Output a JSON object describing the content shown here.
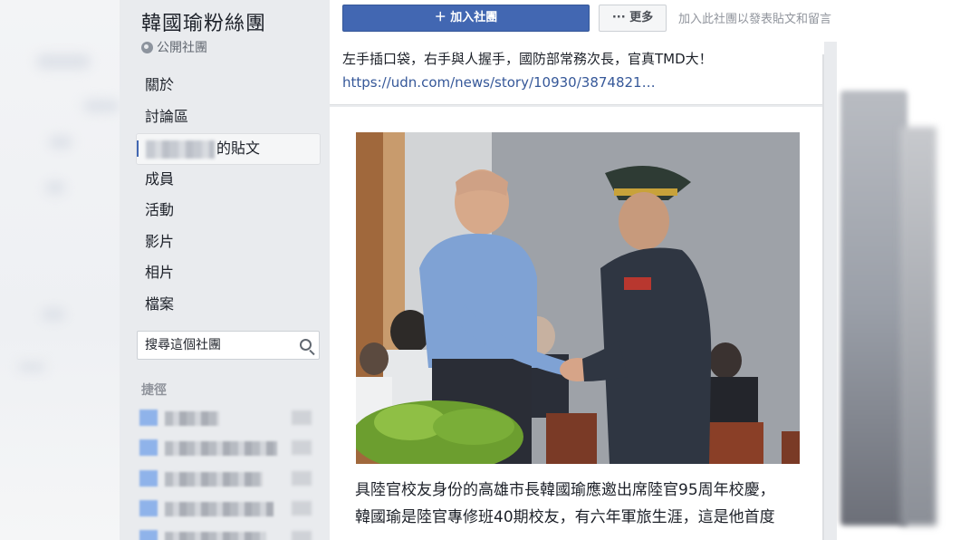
{
  "group": {
    "name": "韓國瑜粉絲團",
    "privacy": "公開社團"
  },
  "nav": {
    "items": [
      {
        "label": "關於"
      },
      {
        "label": "討論區"
      },
      {
        "label": "的貼文"
      },
      {
        "label": "成員"
      },
      {
        "label": "活動"
      },
      {
        "label": "影片"
      },
      {
        "label": "相片"
      },
      {
        "label": "檔案"
      }
    ]
  },
  "search": {
    "placeholder": "搜尋這個社團"
  },
  "shortcuts": {
    "title": "捷徑"
  },
  "toolbar": {
    "join_label": "＋ 加入社團",
    "more_label": "··· 更多",
    "join_hint": "加入此社團以發表貼文和留言"
  },
  "post": {
    "text": "左手插口袋，右手與人握手，國防部常務次長，官真TMD大！",
    "link": "https://udn.com/news/story/10930/3874821…"
  },
  "article": {
    "caption_line1": "具陸官校友身份的高雄市長韓國瑜應邀出席陸官95周年校慶，",
    "caption_line2": "韓國瑜是陸官專修班40期校友，有六年軍旅生涯，這是他首度"
  },
  "colors": {
    "brand": "#4267b2",
    "link": "#365899",
    "sidebar_bg": "#e9ebee"
  }
}
